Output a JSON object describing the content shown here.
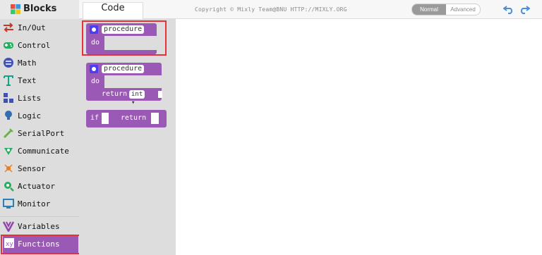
{
  "header": {
    "blocks_tab": "Blocks",
    "code_tab": "Code",
    "copyright": "Copyright © Mixly Team@BNU HTTP://MIXLY.ORG",
    "mode_normal": "Normal",
    "mode_advanced": "Advanced"
  },
  "toolbox": {
    "categories": [
      {
        "label": "In/Out",
        "icon": "in-out-icon",
        "color": "#c0392b"
      },
      {
        "label": "Control",
        "icon": "gamepad-icon",
        "color": "#27ae60"
      },
      {
        "label": "Math",
        "icon": "math-icon",
        "color": "#3f51b5"
      },
      {
        "label": "Text",
        "icon": "text-icon",
        "color": "#16a085"
      },
      {
        "label": "Lists",
        "icon": "lists-icon",
        "color": "#3f51b5"
      },
      {
        "label": "Logic",
        "icon": "bulb-icon",
        "color": "#2f6fb0"
      },
      {
        "label": "SerialPort",
        "icon": "serial-icon",
        "color": "#6ab04c"
      },
      {
        "label": "Communicate",
        "icon": "antenna-icon",
        "color": "#27ae60"
      },
      {
        "label": "Sensor",
        "icon": "sensor-icon",
        "color": "#e67e22"
      },
      {
        "label": "Actuator",
        "icon": "actuator-icon",
        "color": "#27ae60"
      },
      {
        "label": "Monitor",
        "icon": "monitor-icon",
        "color": "#2980b9"
      },
      {
        "label": "Variables",
        "icon": "variables-icon",
        "color": "#8e44ad"
      },
      {
        "label": "Functions",
        "icon": "function-icon",
        "color": "#f1c40f"
      }
    ],
    "selected": "Functions"
  },
  "flyout": {
    "block1": {
      "name": "procedure",
      "do_label": "do"
    },
    "block2": {
      "name": "procedure",
      "do_label": "do",
      "return_label": "return",
      "type": "int"
    },
    "block3": {
      "if_label": "if",
      "return_label": "return"
    }
  },
  "colors": {
    "function_block": "#9b59b6",
    "highlight": "#e8303a"
  }
}
